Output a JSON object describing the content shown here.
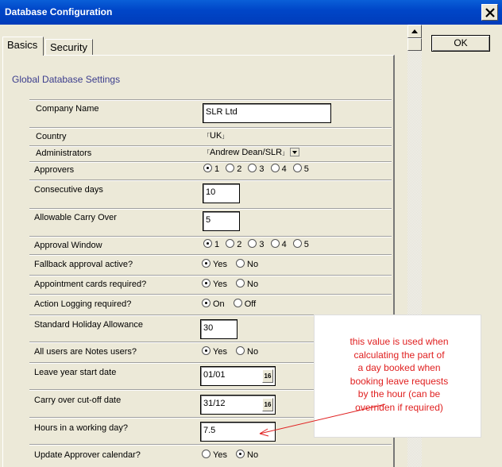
{
  "window": {
    "title": "Database Configuration",
    "ok_label": "OK"
  },
  "tabs": [
    {
      "label": "Basics",
      "active": true
    },
    {
      "label": "Security",
      "active": false
    }
  ],
  "section_title": "Global Database Settings",
  "fields": {
    "company_name": {
      "label": "Company Name",
      "value": "SLR Ltd"
    },
    "country": {
      "label": "Country",
      "value": "UK"
    },
    "administrators": {
      "label": "Administrators",
      "value": "Andrew Dean/SLR"
    },
    "approvers": {
      "label": "Approvers",
      "options": [
        "1",
        "2",
        "3",
        "4",
        "5"
      ],
      "selected": "1"
    },
    "consecutive_days": {
      "label": "Consecutive days",
      "value": "10"
    },
    "allowable_carry_over": {
      "label": "Allowable Carry Over",
      "value": "5"
    },
    "approval_window": {
      "label": "Approval Window",
      "options": [
        "1",
        "2",
        "3",
        "4",
        "5"
      ],
      "selected": "1"
    },
    "fallback_approval": {
      "label": "Fallback approval active?",
      "options": [
        "Yes",
        "No"
      ],
      "selected": "Yes"
    },
    "appointment_cards": {
      "label": "Appointment cards required?",
      "options": [
        "Yes",
        "No"
      ],
      "selected": "Yes"
    },
    "action_logging": {
      "label": "Action Logging required?",
      "options": [
        "On",
        "Off"
      ],
      "selected": "On"
    },
    "standard_holiday": {
      "label": "Standard Holiday Allowance",
      "value": "30"
    },
    "all_users_notes": {
      "label": "All users are Notes users?",
      "options": [
        "Yes",
        "No"
      ],
      "selected": "Yes"
    },
    "leave_year_start": {
      "label": "Leave year start date",
      "value": "01/01"
    },
    "carry_over_cutoff": {
      "label": "Carry over cut-off date",
      "value": "31/12"
    },
    "hours_working_day": {
      "label": "Hours in a working day?",
      "value": "7.5"
    },
    "update_approver_calendar": {
      "label": "Update Approver calendar?",
      "options": [
        "Yes",
        "No"
      ],
      "selected": "No"
    }
  },
  "datepicker_label": "16",
  "callout": {
    "lines": [
      "this value is used when",
      "calculating the part of",
      "a day booked when",
      "booking leave requests",
      "by the hour (can be",
      "overriden if required)"
    ],
    "color": "#e02020"
  },
  "colors": {
    "titlebar": "#0046c8",
    "section_title": "#3b3d8d",
    "dialog_bg": "#ece9d8"
  }
}
